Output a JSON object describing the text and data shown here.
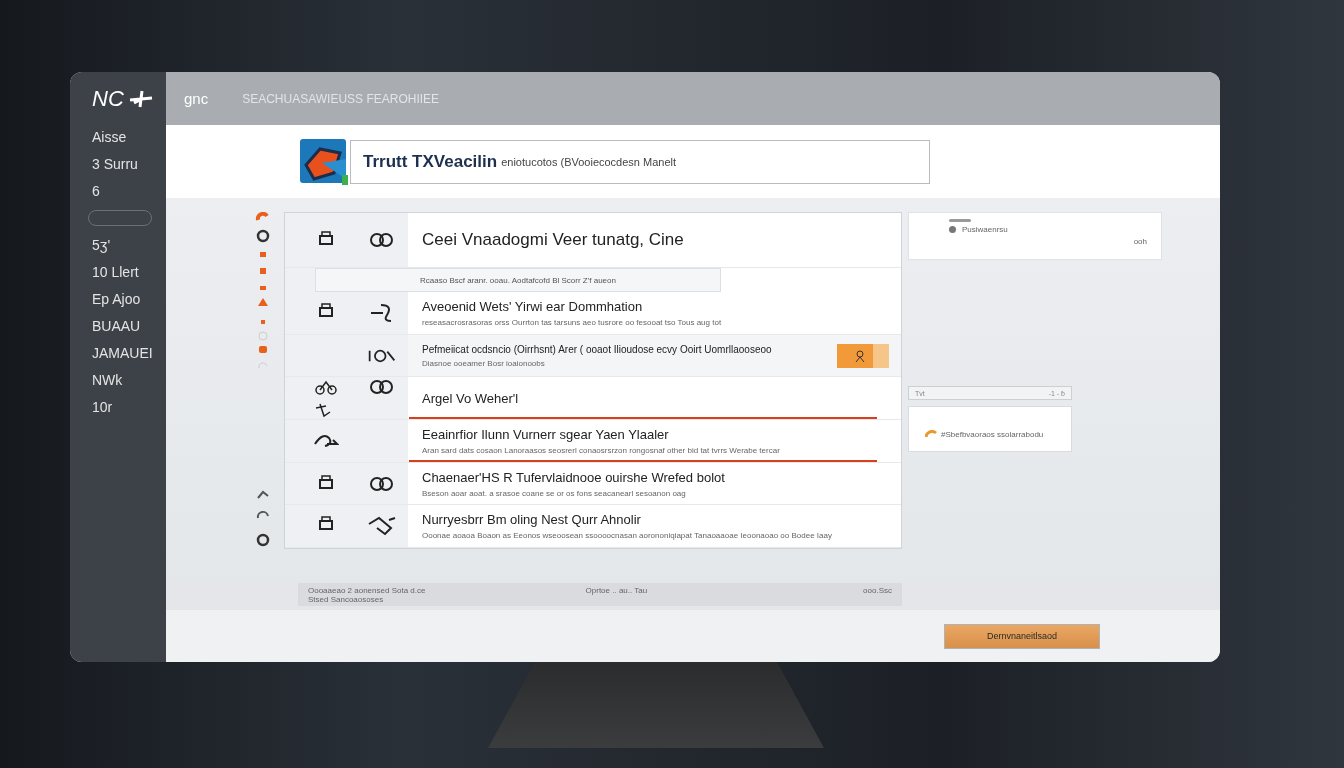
{
  "sidebar": {
    "logo": "NC",
    "items": [
      "Aisse",
      "3 Surru",
      "6",
      "5ʒ'",
      "10 Llert",
      "Ep Ajoo",
      "BUAAU",
      "JAMAUEI",
      "NWk",
      "10r"
    ]
  },
  "top_bar": {
    "app_label": "ɡnc",
    "subtitle": "SEACHUASAWIEUSS FEAROHIIEE"
  },
  "search": {
    "brand": "Trrutt TXVeacilin",
    "value": "eniotucotos (BVooiecocdesn Manelt"
  },
  "list": {
    "rows": [
      {
        "kind": "heading",
        "title": "Ceei Vnaadogmi Veer tunatg, Cine"
      },
      {
        "kind": "banner",
        "title": "Rcaaso Bscf aranr. ooau. Aodtafcofd Bl Scorr Z'f aueon"
      },
      {
        "kind": "item",
        "title": "Aveoenid Wets' Yirwi ear Dommhation",
        "detail": "reseasacrosrasoras orss  Ourrton tas tarsuns  aeo tusrore oo fesooat tso Tous aug tot"
      },
      {
        "kind": "highlight",
        "title": "Pefmeiicat ocdsncio (Oirrhsnt) Arer ( ooaot Ilioudose ecvy Ooirt Uomrllaooseoo",
        "detail": "Diasnoe ooeamer  Bosr ioaionoobs"
      },
      {
        "kind": "underlined",
        "title": "Argel Vo Weher'l"
      },
      {
        "kind": "underlined",
        "title": "Eeainrfior Ilunn  Vurnerr sgear Yaen Ylaaler",
        "detail": "Aran sard dats cosaon  Lanoraasos seosrerl conaosrsrzon rongosnaf other bid tat tvrrs Werabe tercar"
      },
      {
        "kind": "item",
        "title": "Chaenaer'HS R Tufervlaidnooe ouirshe Wrefed bolot",
        "detail": "Bseson aoar aoat. a srasoe  coane se or os  fons seacanearl sesoanon oag"
      },
      {
        "kind": "item",
        "title": "Nurryesbrr Bm oling Nest Qurr Ahnolir",
        "detail": "Ooonae aoaoa Boaon as  Eeonos wseoosean ssoooocnasan aorononiqiapat Tanaoaaoae Ieoonaoao oo Bodee Iaay"
      }
    ]
  },
  "preview_card": {
    "label": "Pusiwaenrsu",
    "meta": "ooh"
  },
  "range_bar": {
    "label": "Tvt",
    "meta": "-1 - ɓ"
  },
  "result_card": {
    "label": "#Sbefbvaoraos ssolarrabodu"
  },
  "footer_table": {
    "columns": [
      [
        "Oooaaeao 2 aonensed Sota d.ce",
        "Stsed Sancoaososes"
      ],
      [
        "Oprtoe ..  au.. Tau"
      ],
      [
        "ooo.Ssc"
      ]
    ]
  },
  "button": "Dernvnaneitlsaod"
}
